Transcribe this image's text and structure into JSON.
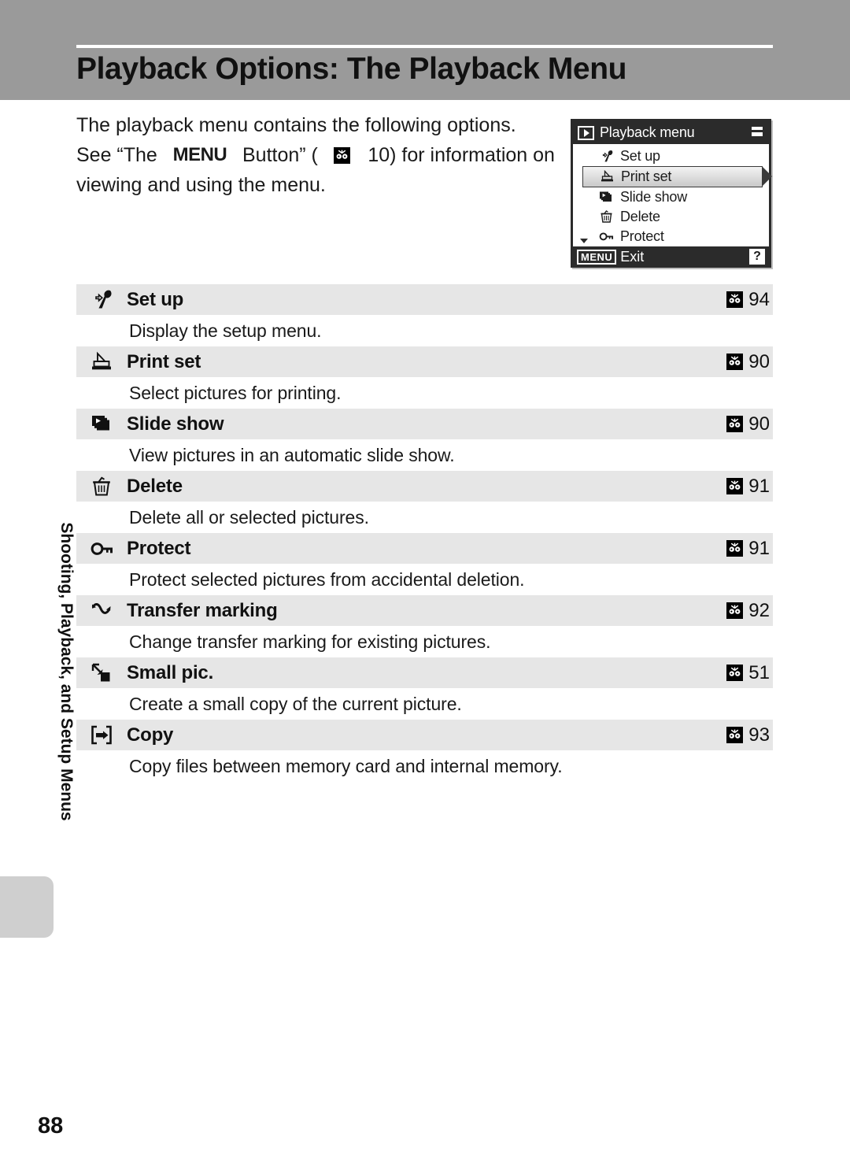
{
  "header": {
    "title": "Playback Options: The Playback Menu"
  },
  "side_tab": {
    "label": "Shooting, Playback, and Setup Menus"
  },
  "intro": {
    "line1": "The playback menu contains the following options.",
    "line2_a": "See “The",
    "line2_menu": "MENU",
    "line2_b": "Button” (",
    "line2_page": "10) for information on",
    "line3": "viewing and using the menu."
  },
  "lcd": {
    "title": "Playback menu",
    "play_icon": "play-icon",
    "battery_icon": "battery-icon",
    "items": [
      {
        "label": "Set up",
        "icon": "wrench-icon",
        "selected": false
      },
      {
        "label": "Print set",
        "icon": "printer-icon",
        "selected": true
      },
      {
        "label": "Slide show",
        "icon": "slideshow-icon",
        "selected": false
      },
      {
        "label": "Delete",
        "icon": "trash-icon",
        "selected": false
      },
      {
        "label": "Protect",
        "icon": "key-icon",
        "selected": false
      }
    ],
    "footer": {
      "menu_chip": "MENU",
      "exit_label": "Exit",
      "help_label": "?"
    }
  },
  "options": [
    {
      "icon": "wrench-icon",
      "name": "Set up",
      "page": "94",
      "description": "Display the setup menu."
    },
    {
      "icon": "printer-icon",
      "name": "Print set",
      "page": "90",
      "description": "Select pictures for printing."
    },
    {
      "icon": "slideshow-icon",
      "name": "Slide show",
      "page": "90",
      "description": "View pictures in an automatic slide show."
    },
    {
      "icon": "trash-icon",
      "name": "Delete",
      "page": "91",
      "description": "Delete all or selected pictures."
    },
    {
      "icon": "key-icon",
      "name": "Protect",
      "page": "91",
      "description": "Protect selected pictures from accidental deletion."
    },
    {
      "icon": "transfer-icon",
      "name": "Transfer marking",
      "page": "92",
      "description": "Change transfer marking for existing pictures."
    },
    {
      "icon": "smallpic-icon",
      "name": "Small pic.",
      "page": "51",
      "description": "Create a small copy of the current picture."
    },
    {
      "icon": "copy-icon",
      "name": "Copy",
      "page": "93",
      "description": "Copy files between memory card and internal memory."
    }
  ],
  "footer": {
    "page_number": "88"
  },
  "colors": {
    "header_band": "#9a9a9a",
    "row_shade": "#e6e6e6",
    "side_tab": "#cfcfcf",
    "lcd_dark": "#2b2b2b"
  }
}
